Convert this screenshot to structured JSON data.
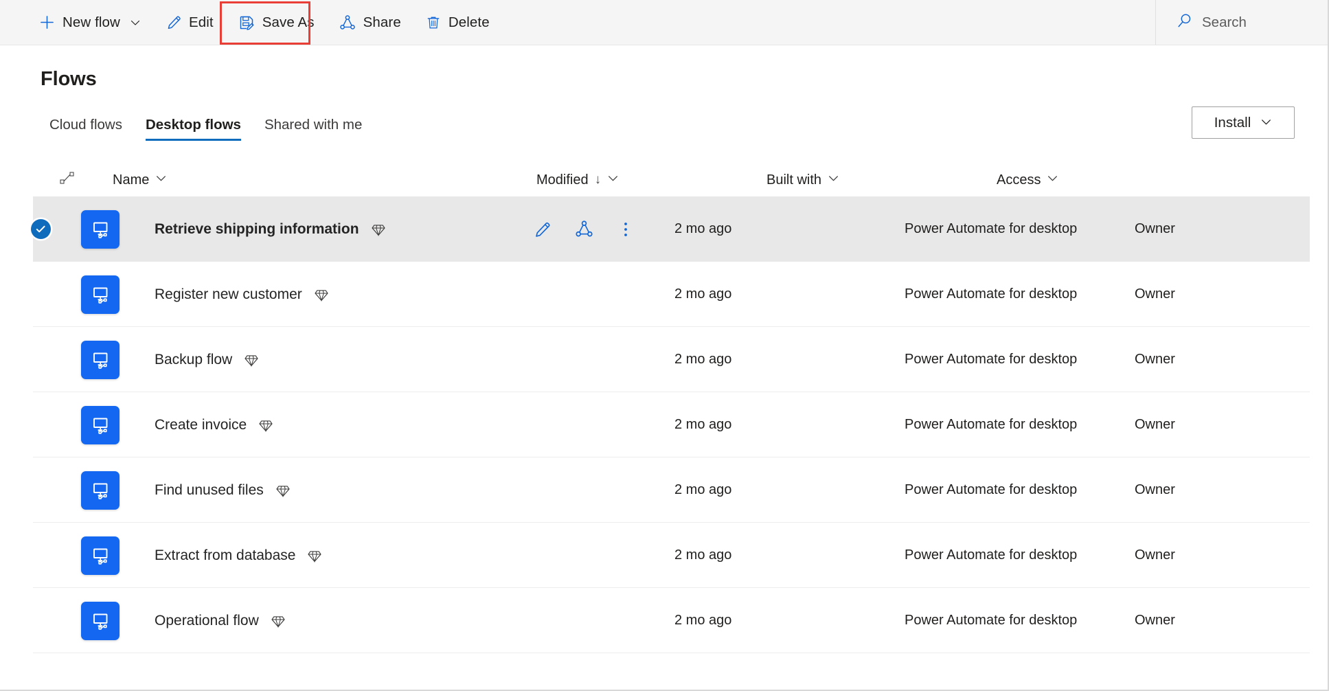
{
  "toolbar": {
    "buttons": [
      {
        "label": "New flow",
        "icon": "plus-icon",
        "caret": true
      },
      {
        "label": "Edit",
        "icon": "pencil-icon",
        "caret": false
      },
      {
        "label": "Save As",
        "icon": "save-as-icon",
        "caret": false
      },
      {
        "label": "Share",
        "icon": "share-icon",
        "caret": false
      },
      {
        "label": "Delete",
        "icon": "trash-icon",
        "caret": false
      }
    ],
    "highlighted_button": "Save As",
    "highlight_color": "#e83e36",
    "search": {
      "label": "Search",
      "icon": "search-icon"
    }
  },
  "header": {
    "title": "Flows",
    "install": {
      "label": "Install",
      "icon": "chevron-down-icon"
    }
  },
  "tabs": [
    {
      "label": "Cloud flows",
      "active": false
    },
    {
      "label": "Desktop flows",
      "active": true
    },
    {
      "label": "Shared with me",
      "active": false
    }
  ],
  "table": {
    "columns": {
      "type_icon": "flow-type-icon",
      "name": "Name",
      "modified": "Modified",
      "modified_sort": "↓",
      "built_with": "Built with",
      "access": "Access",
      "caret": "⌄"
    },
    "rows": [
      {
        "name": "Retrieve shipping information",
        "premium": true,
        "modified": "2 mo ago",
        "built_with": "Power Automate for desktop",
        "access": "Owner",
        "selected": true
      },
      {
        "name": "Register new customer",
        "premium": true,
        "modified": "2 mo ago",
        "built_with": "Power Automate for desktop",
        "access": "Owner",
        "selected": false
      },
      {
        "name": "Backup flow",
        "premium": true,
        "modified": "2 mo ago",
        "built_with": "Power Automate for desktop",
        "access": "Owner",
        "selected": false
      },
      {
        "name": "Create invoice",
        "premium": true,
        "modified": "2 mo ago",
        "built_with": "Power Automate for desktop",
        "access": "Owner",
        "selected": false
      },
      {
        "name": "Find unused files",
        "premium": true,
        "modified": "2 mo ago",
        "built_with": "Power Automate for desktop",
        "access": "Owner",
        "selected": false
      },
      {
        "name": "Extract from database",
        "premium": true,
        "modified": "2 mo ago",
        "built_with": "Power Automate for desktop",
        "access": "Owner",
        "selected": false
      },
      {
        "name": "Operational flow",
        "premium": true,
        "modified": "2 mo ago",
        "built_with": "Power Automate for desktop",
        "access": "Owner",
        "selected": false
      }
    ],
    "row_actions": [
      {
        "name": "edit-flow",
        "icon": "pencil-icon"
      },
      {
        "name": "share-flow",
        "icon": "share-icon"
      },
      {
        "name": "more-commands",
        "icon": "ellipsis-vertical-icon"
      }
    ]
  },
  "colors": {
    "accent": "#0f6cbd",
    "icon_blue": "#1266d6",
    "tile_blue": "#1367f0",
    "selected_row": "#e8e8e8",
    "commandbar_bg": "#f5f5f5"
  }
}
